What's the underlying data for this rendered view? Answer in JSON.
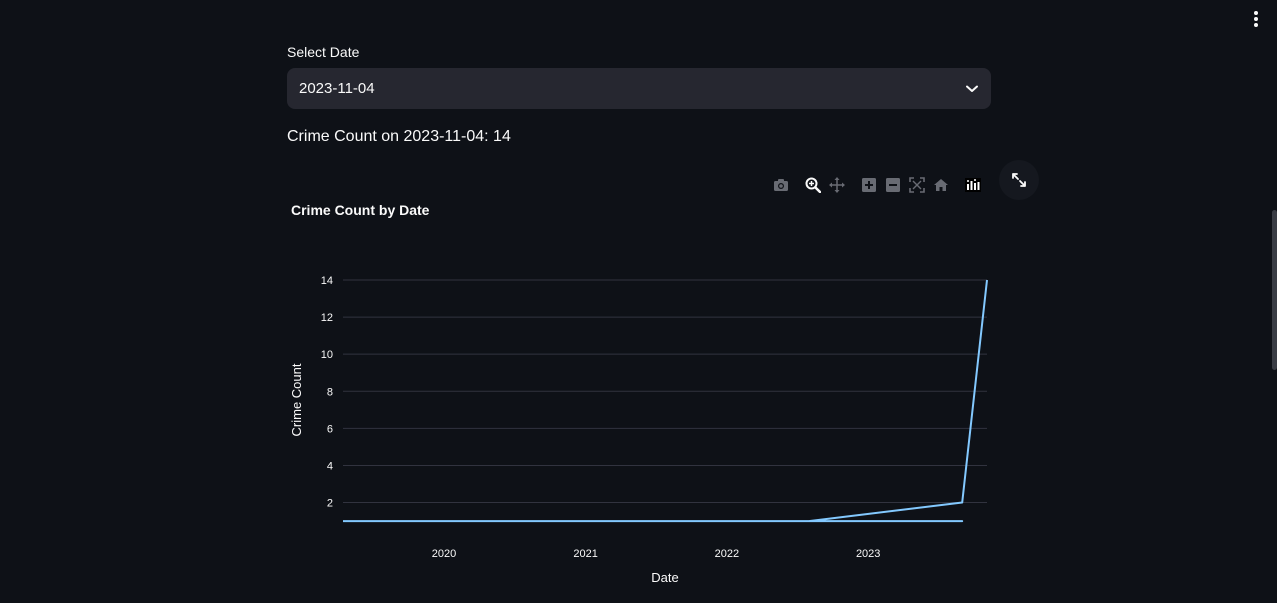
{
  "select": {
    "label": "Select Date",
    "value": "2023-11-04"
  },
  "count_text": "Crime Count on 2023-11-04: 14",
  "toolbar": {
    "icons": [
      "camera-icon",
      "zoom-icon",
      "pan-icon",
      "zoom-in-icon",
      "zoom-out-icon",
      "autoscale-icon",
      "reset-axes-icon",
      "plotly-logo-icon"
    ]
  },
  "chart_data": {
    "type": "line",
    "title": "Crime Count by Date",
    "xlabel": "Date",
    "ylabel": "Crime Count",
    "x_ticks": [
      "2020",
      "2021",
      "2022",
      "2023"
    ],
    "y_ticks": [
      2,
      4,
      6,
      8,
      10,
      12,
      14
    ],
    "xlim": [
      "2019-04-15",
      "2023-11-04"
    ],
    "ylim": [
      0.95,
      14
    ],
    "grid": true,
    "color": "#83c9ff",
    "series": [
      {
        "x": [
          "2019-04-15",
          "2023-09-01",
          "2022-08-01",
          "2023-09-01",
          "2023-11-04"
        ],
        "y": [
          1,
          1,
          1,
          2,
          14
        ]
      }
    ]
  }
}
